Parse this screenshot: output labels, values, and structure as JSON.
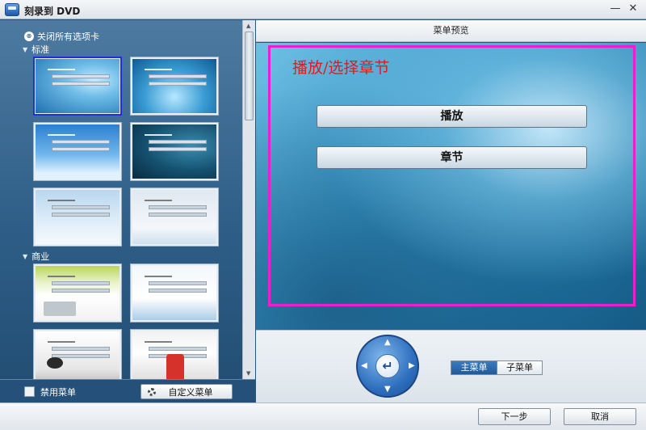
{
  "window": {
    "title": "刻录到 DVD",
    "minimize": "—",
    "close": "✕"
  },
  "left": {
    "close_all_label": "关闭所有选项卡",
    "close_all_icon": "⊗",
    "groups": [
      {
        "label": "标准",
        "arrow": "▼"
      },
      {
        "label": "商业",
        "arrow": "▼"
      }
    ],
    "disable_menu_label": "禁用菜单",
    "custom_menu_label": "自定义菜单"
  },
  "preview": {
    "header": "菜单预览",
    "menu_title": "播放/选择章节",
    "play_label": "播放",
    "chapter_label": "章节",
    "frame_color": "#e81fd2",
    "title_color": "#e21a1a"
  },
  "nav": {
    "center_symbol": "↵",
    "up": "▲",
    "down": "▼",
    "left": "◀",
    "right": "▶",
    "tabs": [
      {
        "label": "主菜单"
      },
      {
        "label": "子菜单"
      }
    ]
  },
  "footer": {
    "next_label": "下一步",
    "cancel_label": "取消"
  }
}
